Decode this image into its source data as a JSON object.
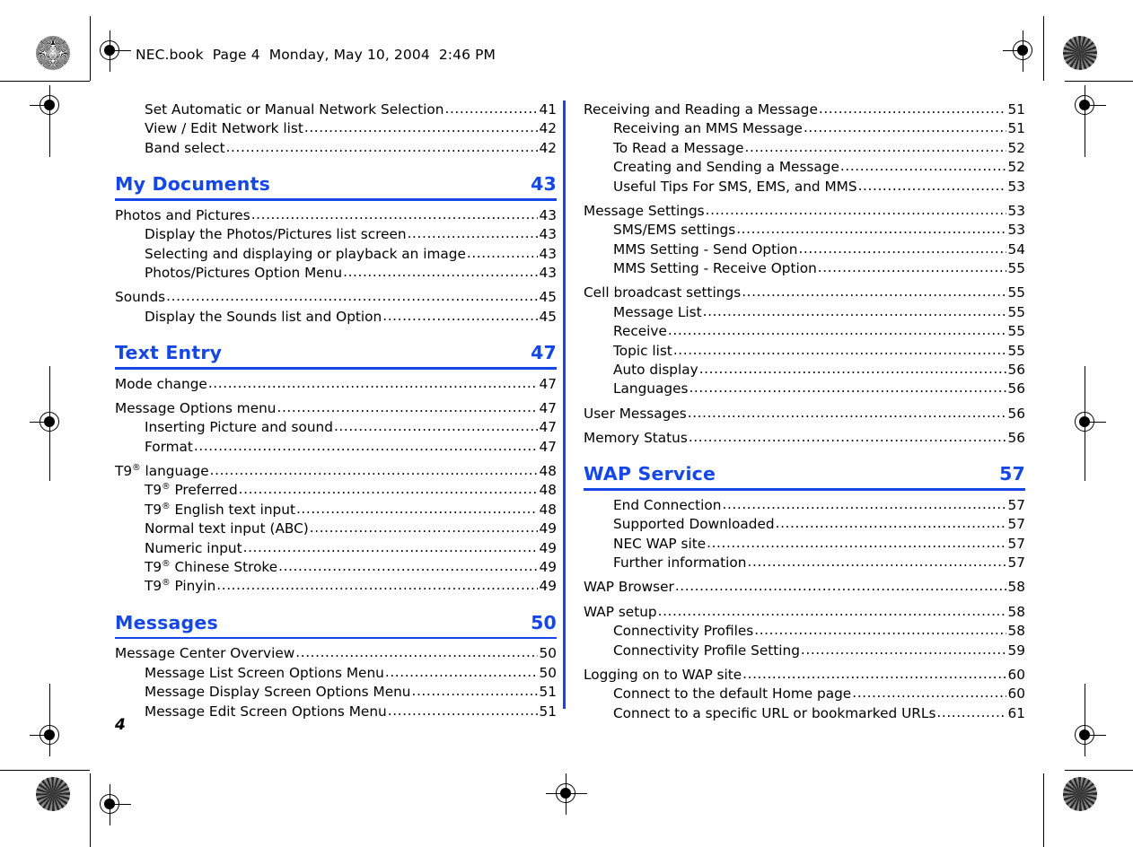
{
  "document": {
    "header_line": "NEC.book  Page 4  Monday, May 10, 2004  2:46 PM",
    "page_number": "4",
    "accent_color": "#1447e6",
    "text_color": "#000000",
    "leader_char": "."
  },
  "left_column": [
    {
      "kind": "entry",
      "level": 2,
      "label": "Set Automatic or Manual Network Selection",
      "page": "41"
    },
    {
      "kind": "entry",
      "level": 2,
      "label": "View / Edit Network list",
      "page": "42"
    },
    {
      "kind": "entry",
      "level": 2,
      "label": "Band select",
      "page": "42"
    },
    {
      "kind": "heading",
      "title": "My Documents",
      "page": "43"
    },
    {
      "kind": "entry",
      "level": 1,
      "label": "Photos and Pictures",
      "page": "43"
    },
    {
      "kind": "entry",
      "level": 2,
      "label": "Display the Photos/Pictures list screen",
      "page": "43"
    },
    {
      "kind": "entry",
      "level": 2,
      "label": "Selecting and displaying or playback an image",
      "page": "43"
    },
    {
      "kind": "entry",
      "level": 2,
      "label": "Photos/Pictures Option Menu",
      "page": "43"
    },
    {
      "kind": "entry",
      "level": 1,
      "label": "Sounds",
      "page": "45"
    },
    {
      "kind": "entry",
      "level": 2,
      "label": "Display the Sounds list and Option",
      "page": "45"
    },
    {
      "kind": "heading",
      "title": "Text Entry",
      "page": "47"
    },
    {
      "kind": "entry",
      "level": 1,
      "label": "Mode change",
      "page": "47"
    },
    {
      "kind": "entry",
      "level": 1,
      "label": "Message Options menu",
      "page": "47"
    },
    {
      "kind": "entry",
      "level": 2,
      "label": "Inserting Picture and sound",
      "page": "47"
    },
    {
      "kind": "entry",
      "level": 2,
      "label": "Format",
      "page": "47"
    },
    {
      "kind": "entry",
      "level": 1,
      "label_html": "T9<sup>®</sup> language",
      "label": "T9® language",
      "page": "48"
    },
    {
      "kind": "entry",
      "level": 2,
      "label_html": "T9<sup>®</sup> Preferred",
      "label": "T9® Preferred",
      "page": "48"
    },
    {
      "kind": "entry",
      "level": 2,
      "label_html": "T9<sup>®</sup> English text input",
      "label": "T9® English text input",
      "page": "48"
    },
    {
      "kind": "entry",
      "level": 2,
      "label": "Normal text input (ABC)",
      "page": "49"
    },
    {
      "kind": "entry",
      "level": 2,
      "label": "Numeric input",
      "page": "49"
    },
    {
      "kind": "entry",
      "level": 2,
      "label_html": "T9<sup>®</sup> Chinese Stroke",
      "label": "T9® Chinese Stroke",
      "page": "49"
    },
    {
      "kind": "entry",
      "level": 2,
      "label_html": "T9<sup>®</sup> Pinyin",
      "label": "T9® Pinyin",
      "page": "49"
    },
    {
      "kind": "heading",
      "title": "Messages",
      "page": "50"
    },
    {
      "kind": "entry",
      "level": 1,
      "label": "Message Center Overview",
      "page": "50"
    },
    {
      "kind": "entry",
      "level": 2,
      "label": "Message List Screen Options Menu",
      "page": "50"
    },
    {
      "kind": "entry",
      "level": 2,
      "label": "Message Display Screen Options Menu",
      "page": "51"
    },
    {
      "kind": "entry",
      "level": 2,
      "label": "Message Edit Screen Options Menu",
      "page": "51"
    }
  ],
  "right_column": [
    {
      "kind": "entry",
      "level": 1,
      "label": "Receiving and Reading a Message",
      "page": "51"
    },
    {
      "kind": "entry",
      "level": 2,
      "label": "Receiving an MMS Message",
      "page": "51"
    },
    {
      "kind": "entry",
      "level": 2,
      "label": "To Read a Message",
      "page": "52"
    },
    {
      "kind": "entry",
      "level": 2,
      "label": "Creating and Sending a Message",
      "page": "52"
    },
    {
      "kind": "entry",
      "level": 2,
      "label": "Useful Tips For SMS, EMS, and MMS",
      "page": "53"
    },
    {
      "kind": "entry",
      "level": 1,
      "label": "Message Settings",
      "page": "53"
    },
    {
      "kind": "entry",
      "level": 2,
      "label": "SMS/EMS settings",
      "page": "53"
    },
    {
      "kind": "entry",
      "level": 2,
      "label": "MMS Setting - Send Option",
      "page": "54"
    },
    {
      "kind": "entry",
      "level": 2,
      "label": "MMS Setting - Receive Option",
      "page": "55"
    },
    {
      "kind": "entry",
      "level": 1,
      "label": "Cell broadcast settings",
      "page": "55"
    },
    {
      "kind": "entry",
      "level": 2,
      "label": "Message List",
      "page": "55"
    },
    {
      "kind": "entry",
      "level": 2,
      "label": "Receive",
      "page": "55"
    },
    {
      "kind": "entry",
      "level": 2,
      "label": "Topic list",
      "page": "55"
    },
    {
      "kind": "entry",
      "level": 2,
      "label": "Auto display",
      "page": "56"
    },
    {
      "kind": "entry",
      "level": 2,
      "label": "Languages",
      "page": "56"
    },
    {
      "kind": "entry",
      "level": 1,
      "label": "User Messages",
      "page": "56"
    },
    {
      "kind": "entry",
      "level": 1,
      "label": "Memory Status",
      "page": "56"
    },
    {
      "kind": "heading",
      "title": "WAP Service",
      "page": "57"
    },
    {
      "kind": "entry",
      "level": 2,
      "label": "End Connection",
      "page": "57"
    },
    {
      "kind": "entry",
      "level": 2,
      "label": "Supported Downloaded",
      "page": "57"
    },
    {
      "kind": "entry",
      "level": 2,
      "label": "NEC WAP site",
      "page": "57"
    },
    {
      "kind": "entry",
      "level": 2,
      "label": "Further information",
      "page": "57"
    },
    {
      "kind": "entry",
      "level": 1,
      "label": "WAP Browser",
      "page": "58"
    },
    {
      "kind": "entry",
      "level": 1,
      "label": "WAP setup",
      "page": "58"
    },
    {
      "kind": "entry",
      "level": 2,
      "label": "Connectivity Profiles",
      "page": "58"
    },
    {
      "kind": "entry",
      "level": 2,
      "label": "Connectivity Profile Setting",
      "page": "59"
    },
    {
      "kind": "entry",
      "level": 1,
      "label": "Logging on to WAP site",
      "page": "60"
    },
    {
      "kind": "entry",
      "level": 2,
      "label": "Connect to the default Home page",
      "page": "60"
    },
    {
      "kind": "entry",
      "level": 2,
      "label": "Connect to a specific URL or bookmarked URLs",
      "page": "61"
    }
  ]
}
